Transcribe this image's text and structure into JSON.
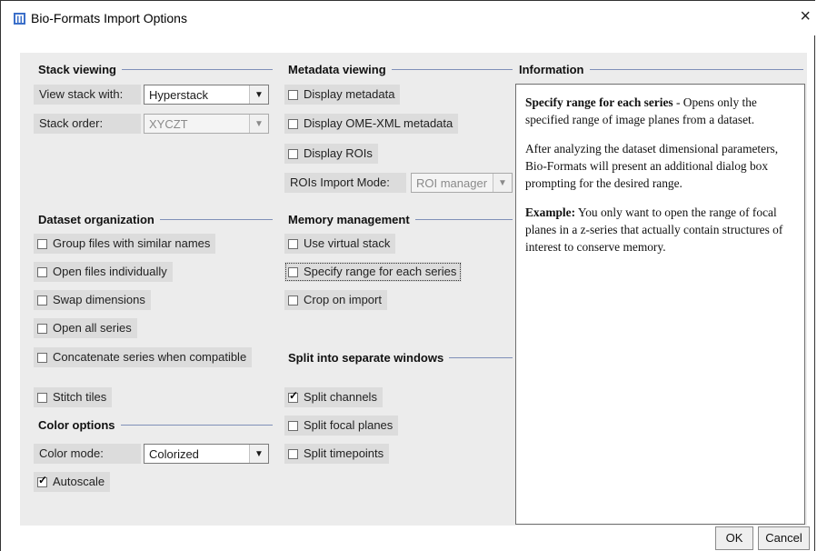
{
  "window": {
    "title": "Bio-Formats Import Options",
    "close_glyph": "×",
    "icon": "bio-formats-icon"
  },
  "stack_viewing": {
    "header": "Stack viewing",
    "view_stack_label": "View stack with:",
    "view_stack_value": "Hyperstack",
    "stack_order_label": "Stack order:",
    "stack_order_value": "XYCZT"
  },
  "metadata_viewing": {
    "header": "Metadata viewing",
    "display_metadata": "Display metadata",
    "display_ome_xml": "Display OME-XML metadata",
    "display_rois": "Display ROIs",
    "rois_mode_label": "ROIs Import Mode:",
    "rois_mode_value": "ROI manager"
  },
  "information": {
    "header": "Information",
    "p1_bold": "Specify range for each series",
    "p1_rest": " - Opens only the specified range of image planes from a dataset.",
    "p2": "After analyzing the dataset dimensional parameters, Bio-Formats will present an additional dialog box prompting for the desired range.",
    "p3_bold": "Example:",
    "p3_rest": " You only want to open the range of focal planes in a z-series that actually contain structures of interest to conserve memory."
  },
  "dataset_org": {
    "header": "Dataset organization",
    "group_files": "Group files with similar names",
    "open_individually": "Open files individually",
    "swap_dims": "Swap dimensions",
    "open_all": "Open all series",
    "concatenate": "Concatenate series when compatible",
    "stitch": "Stitch tiles"
  },
  "memory": {
    "header": "Memory management",
    "virtual_stack": "Use virtual stack",
    "specify_range": "Specify range for each series",
    "crop": "Crop on import"
  },
  "split": {
    "header": "Split into separate windows",
    "channels": "Split channels",
    "focal": "Split focal planes",
    "timepoints": "Split timepoints"
  },
  "color": {
    "header": "Color options",
    "mode_label": "Color mode:",
    "mode_value": "Colorized",
    "autoscale": "Autoscale"
  },
  "buttons": {
    "ok": "OK",
    "cancel": "Cancel"
  },
  "checked": {
    "split_channels": true,
    "autoscale": true
  }
}
